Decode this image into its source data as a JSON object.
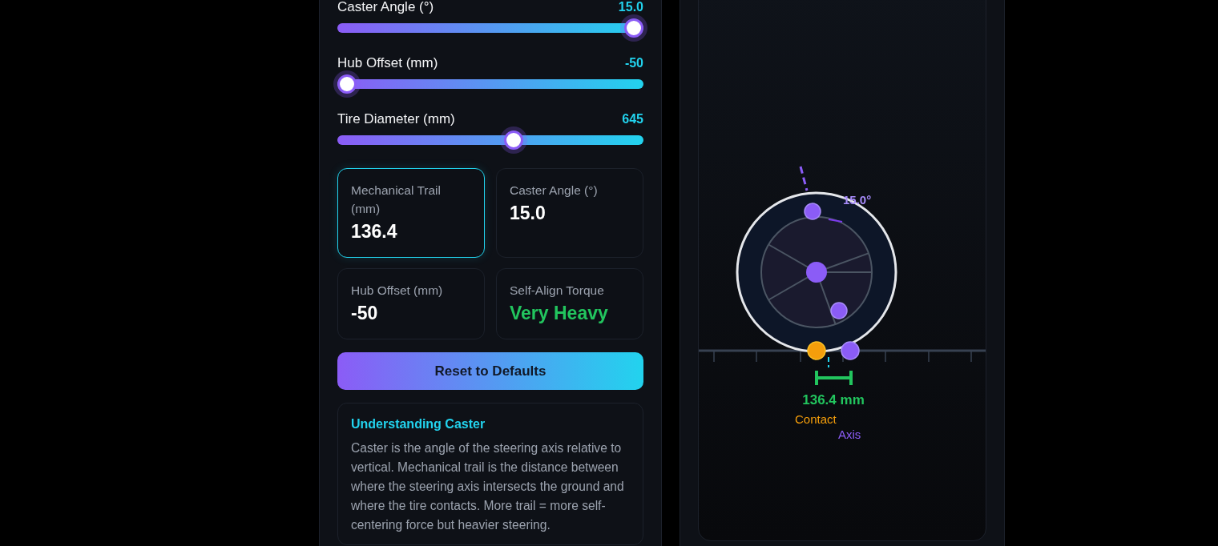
{
  "sliders": [
    {
      "label": "Caster Angle (°)",
      "value": "15.0",
      "level": 1
    },
    {
      "label": "Hub Offset (mm)",
      "value": "-50",
      "level": 0
    },
    {
      "label": "Tire Diameter (mm)",
      "value": "645",
      "level": 0.58
    }
  ],
  "stats": [
    {
      "label": "Mechanical Trail (mm)",
      "value": "136.4",
      "selected": true,
      "color": "#ffffff"
    },
    {
      "label": "Caster Angle (°)",
      "value": "15.0",
      "selected": false,
      "color": "#ffffff"
    },
    {
      "label": "Hub Offset (mm)",
      "value": "-50",
      "selected": false,
      "color": "#ffffff"
    },
    {
      "label": "Self-Align Torque",
      "value": "Very Heavy",
      "selected": false,
      "color": "#22c55e"
    }
  ],
  "reset_button": "Reset to Defaults",
  "info": {
    "title": "Understanding Caster",
    "text": "Caster is the angle of the steering axis relative to vertical. Mechanical trail is the distance between where the steering axis intersects the ground and where the tire contacts. More trail = more self-centering force but heavier steering."
  },
  "diagram": {
    "angle_label": "15.0°",
    "trail_label": "136.4 mm",
    "contact_label": "Contact",
    "axis_label": "Axis"
  }
}
